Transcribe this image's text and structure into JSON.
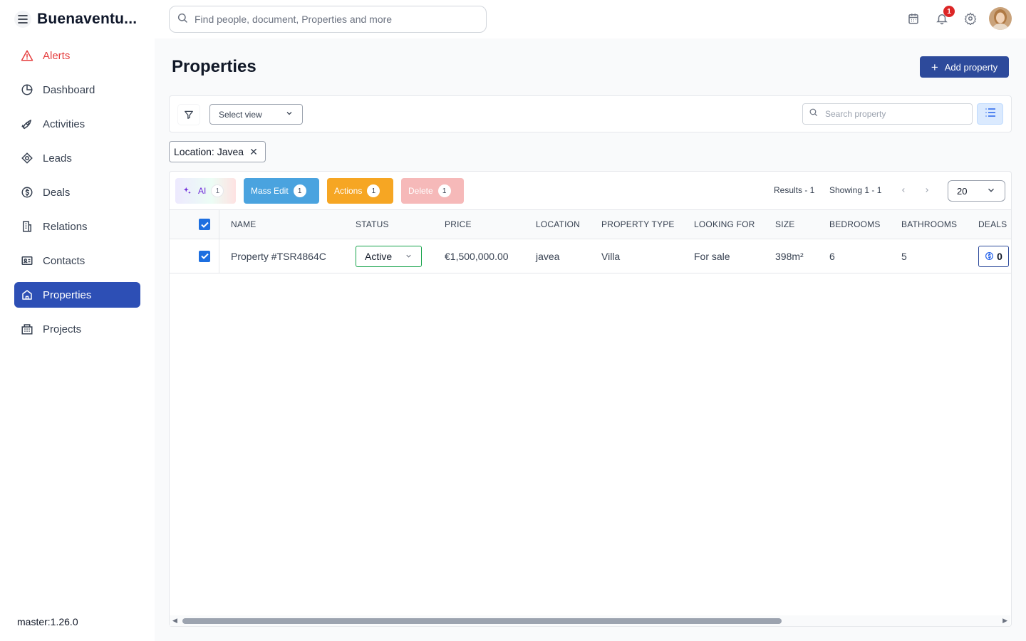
{
  "app": {
    "title": "Buenaventu...",
    "version": "master:1.26.0"
  },
  "topbar": {
    "search_placeholder": "Find people, document, Properties and more",
    "notification_count": "1"
  },
  "sidebar": {
    "items": [
      {
        "label": "Alerts",
        "icon": "alert-triangle-icon"
      },
      {
        "label": "Dashboard",
        "icon": "pie-chart-icon"
      },
      {
        "label": "Activities",
        "icon": "rocket-icon"
      },
      {
        "label": "Leads",
        "icon": "target-icon"
      },
      {
        "label": "Deals",
        "icon": "dollar-circle-icon"
      },
      {
        "label": "Relations",
        "icon": "building-icon"
      },
      {
        "label": "Contacts",
        "icon": "contact-card-icon"
      },
      {
        "label": "Properties",
        "icon": "home-icon"
      },
      {
        "label": "Projects",
        "icon": "city-icon"
      }
    ],
    "active": "Properties"
  },
  "page": {
    "title": "Properties",
    "add_button": "Add property"
  },
  "filters": {
    "select_view_placeholder": "Select view",
    "search_placeholder": "Search property",
    "chip": "Location: Javea"
  },
  "toolbar": {
    "ai_label": "AI",
    "ai_count": "1",
    "mass_edit_label": "Mass Edit",
    "mass_edit_count": "1",
    "actions_label": "Actions",
    "actions_count": "1",
    "delete_label": "Delete",
    "delete_count": "1",
    "results": "Results - 1",
    "showing": "Showing 1 - 1",
    "per_page": "20"
  },
  "table": {
    "columns": [
      "NAME",
      "STATUS",
      "PRICE",
      "LOCATION",
      "PROPERTY TYPE",
      "LOOKING FOR",
      "SIZE",
      "BEDROOMS",
      "BATHROOMS",
      "DEALS"
    ],
    "rows": [
      {
        "name": "Property #TSR4864C",
        "status": "Active",
        "price": "€1,500,000.00",
        "location": "javea",
        "property_type": "Villa",
        "looking_for": "For sale",
        "size": "398m²",
        "bedrooms": "6",
        "bathrooms": "5",
        "deals": "0"
      }
    ]
  },
  "colors": {
    "primary": "#2d4fb5",
    "alert": "#e53e3e",
    "mass_edit": "#4aa3df",
    "actions": "#f6a623",
    "delete": "#f6b9b9",
    "status_active": "#16a34a"
  }
}
